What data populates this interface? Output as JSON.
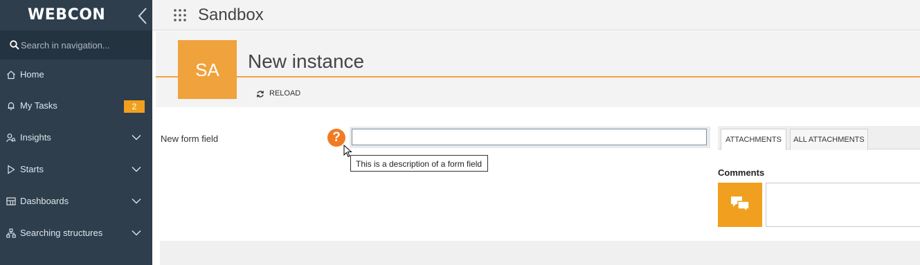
{
  "sidebar": {
    "logo": "WEBCON",
    "search_placeholder": "Search in navigation...",
    "items": [
      {
        "label": "Home",
        "icon": "home-icon"
      },
      {
        "label": "My Tasks",
        "icon": "bell-icon",
        "badge": "2"
      },
      {
        "label": "Insights",
        "icon": "user-search-icon"
      },
      {
        "label": "Starts",
        "icon": "play-icon"
      },
      {
        "label": "Dashboards",
        "icon": "dashboard-icon"
      },
      {
        "label": "Searching structures",
        "icon": "org-chart-icon"
      }
    ]
  },
  "topbar": {
    "title": "Sandbox"
  },
  "header": {
    "avatar": "SA",
    "title": "New instance",
    "reload_label": "RELOAD"
  },
  "form": {
    "field_label": "New form field",
    "field_value": "",
    "tooltip": "This is a description of a form field"
  },
  "right_panel": {
    "tabs": [
      "ATTACHMENTS",
      "ALL ATTACHMENTS"
    ],
    "comments_title": "Comments"
  },
  "colors": {
    "sidebar": "#2e3e4c",
    "accent": "#f0a23c",
    "help": "#f07b24"
  }
}
